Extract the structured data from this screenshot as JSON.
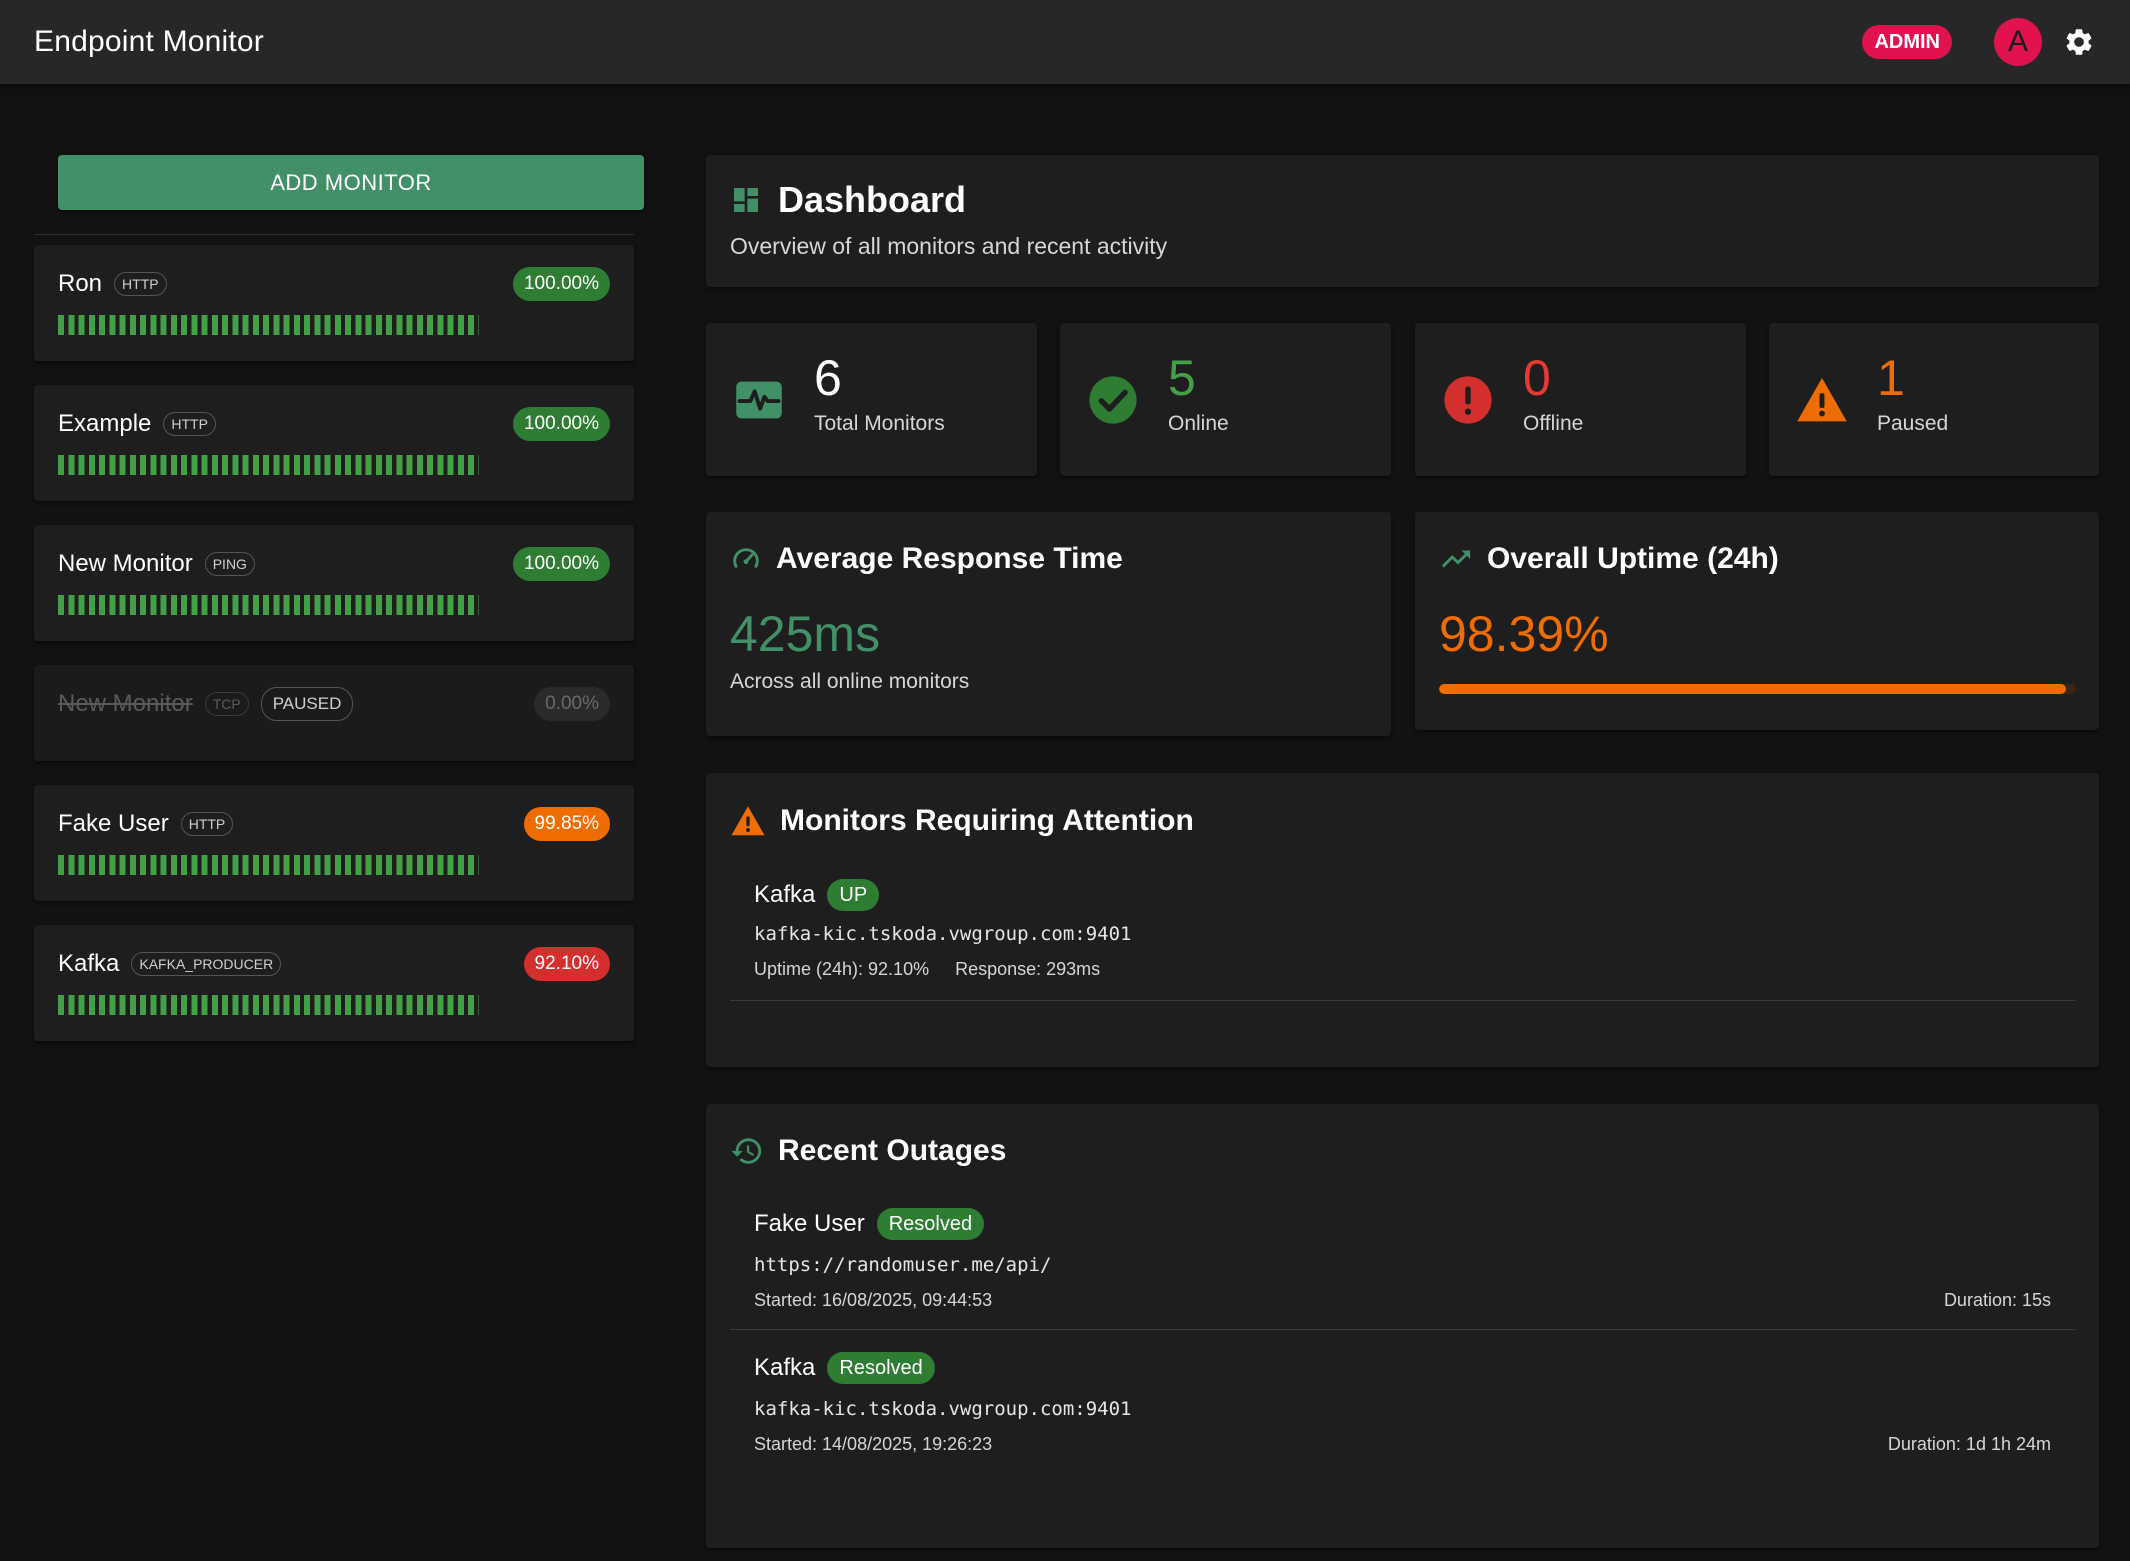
{
  "app": {
    "title": "Endpoint Monitor",
    "role_badge": "ADMIN",
    "avatar_letter": "A"
  },
  "sidebar": {
    "add_button": "ADD MONITOR",
    "monitors": [
      {
        "name": "Ron",
        "type": "HTTP",
        "uptime": "100.00%",
        "status_color": "green",
        "paused": false
      },
      {
        "name": "Example",
        "type": "HTTP",
        "uptime": "100.00%",
        "status_color": "green",
        "paused": false
      },
      {
        "name": "New Monitor",
        "type": "PING",
        "uptime": "100.00%",
        "status_color": "green",
        "paused": false
      },
      {
        "name": "New Monitor",
        "type": "TCP",
        "paused_label": "PAUSED",
        "uptime": "0.00%",
        "status_color": "grey",
        "paused": true
      },
      {
        "name": "Fake User",
        "type": "HTTP",
        "uptime": "99.85%",
        "status_color": "orange",
        "paused": false
      },
      {
        "name": "Kafka",
        "type": "KAFKA_PRODUCER",
        "uptime": "92.10%",
        "status_color": "red",
        "paused": false
      }
    ]
  },
  "dashboard": {
    "title": "Dashboard",
    "subtitle": "Overview of all monitors and recent activity",
    "stats": {
      "total": {
        "value": "6",
        "label": "Total Monitors",
        "color": "#ffffff"
      },
      "online": {
        "value": "5",
        "label": "Online",
        "color": "#43a047"
      },
      "offline": {
        "value": "0",
        "label": "Offline",
        "color": "#e53935"
      },
      "paused": {
        "value": "1",
        "label": "Paused",
        "color": "#ef6c00"
      }
    },
    "response": {
      "title": "Average Response Time",
      "value": "425ms",
      "subtitle": "Across all online monitors",
      "color": "#419068"
    },
    "uptime": {
      "title": "Overall Uptime (24h)",
      "value": "98.39%",
      "percent": 98.39,
      "color": "#ef6c00"
    },
    "attention": {
      "title": "Monitors Requiring Attention",
      "items": [
        {
          "name": "Kafka",
          "status": "UP",
          "url": "kafka-kic.tskoda.vwgroup.com:9401",
          "uptime": "Uptime (24h): 92.10%",
          "response": "Response: 293ms"
        }
      ]
    },
    "outages": {
      "title": "Recent Outages",
      "items": [
        {
          "name": "Fake User",
          "status": "Resolved",
          "url": "https://randomuser.me/api/",
          "started": "Started: 16/08/2025, 09:44:53",
          "duration": "Duration: 15s"
        },
        {
          "name": "Kafka",
          "status": "Resolved",
          "url": "kafka-kic.tskoda.vwgroup.com:9401",
          "started": "Started: 14/08/2025, 19:26:23",
          "duration": "Duration: 1d 1h 24m"
        }
      ]
    }
  },
  "colors": {
    "accent": "#419068",
    "admin": "#e0134e",
    "success": "#2e7d32",
    "warning": "#ef6c00",
    "error": "#d32f2f"
  },
  "icons": [
    "gear-icon",
    "dashboard-icon",
    "heart-pulse-icon",
    "check-circle-icon",
    "error-circle-icon",
    "warning-triangle-icon",
    "speedometer-icon",
    "trending-up-icon",
    "history-icon"
  ]
}
